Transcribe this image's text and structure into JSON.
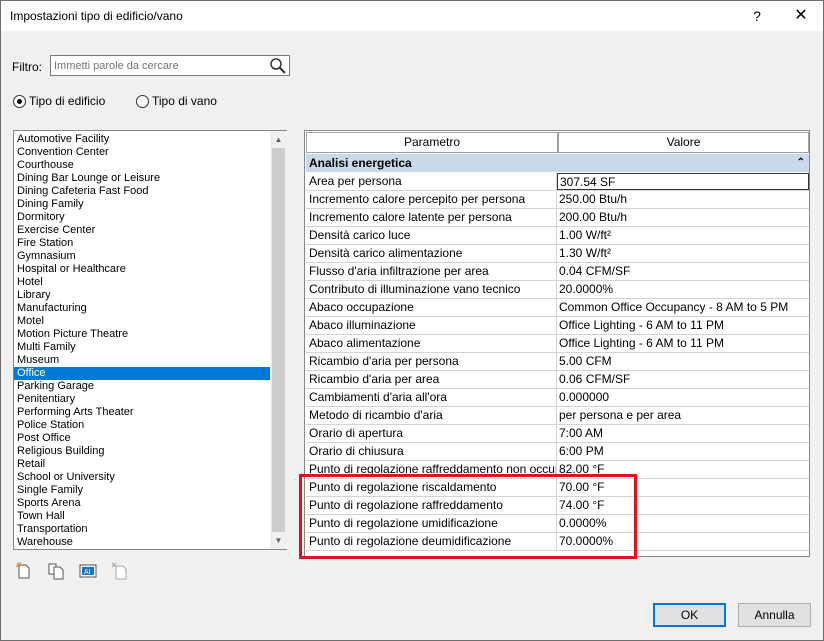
{
  "window": {
    "title": "Impostazioni tipo di edificio/vano",
    "help_label": "?",
    "close_label": "✕"
  },
  "filter": {
    "label": "Filtro:",
    "placeholder": "Immetti parole da cercare",
    "value": ""
  },
  "radios": [
    {
      "label": "Tipo di edificio",
      "checked": true
    },
    {
      "label": "Tipo di vano",
      "checked": false
    }
  ],
  "building_types": [
    "Automotive Facility",
    "Convention Center",
    "Courthouse",
    "Dining Bar Lounge or Leisure",
    "Dining Cafeteria Fast Food",
    "Dining Family",
    "Dormitory",
    "Exercise Center",
    "Fire Station",
    "Gymnasium",
    "Hospital or Healthcare",
    "Hotel",
    "Library",
    "Manufacturing",
    "Motel",
    "Motion Picture Theatre",
    "Multi Family",
    "Museum",
    "Office",
    "Parking Garage",
    "Penitentiary",
    "Performing Arts Theater",
    "Police Station",
    "Post Office",
    "Religious Building",
    "Retail",
    "School or University",
    "Single Family",
    "Sports Arena",
    "Town Hall",
    "Transportation",
    "Warehouse"
  ],
  "selected_type": "Office",
  "list_tools": [
    "new-type-icon",
    "duplicate-icon",
    "rename-icon",
    "delete-icon"
  ],
  "grid": {
    "col_param": "Parametro",
    "col_value": "Valore",
    "group": "Analisi energetica",
    "group_toggle": "⌃",
    "rows": [
      {
        "name": "Area per persona",
        "value": "307.54 SF"
      },
      {
        "name": "Incremento calore percepito per persona",
        "value": "250.00 Btu/h"
      },
      {
        "name": "Incremento calore latente per persona",
        "value": "200.00 Btu/h"
      },
      {
        "name": "Densità carico luce",
        "value": "1.00 W/ft²"
      },
      {
        "name": "Densità carico alimentazione",
        "value": "1.30 W/ft²"
      },
      {
        "name": "Flusso d'aria infiltrazione per area",
        "value": "0.04 CFM/SF"
      },
      {
        "name": "Contributo di illuminazione vano tecnico",
        "value": "20.0000%"
      },
      {
        "name": "Abaco occupazione",
        "value": "Common Office Occupancy - 8 AM to 5 PM"
      },
      {
        "name": "Abaco illuminazione",
        "value": "Office Lighting - 6 AM to 11 PM"
      },
      {
        "name": "Abaco alimentazione",
        "value": "Office Lighting - 6 AM to 11 PM"
      },
      {
        "name": "Ricambio d'aria per persona",
        "value": "5.00 CFM"
      },
      {
        "name": "Ricambio d'aria per area",
        "value": "0.06 CFM/SF"
      },
      {
        "name": "Cambiamenti d'aria all'ora",
        "value": "0.000000"
      },
      {
        "name": "Metodo di ricambio d'aria",
        "value": "per persona e per area"
      },
      {
        "name": "Orario di apertura",
        "value": "7:00 AM"
      },
      {
        "name": "Orario di chiusura",
        "value": "6:00 PM"
      },
      {
        "name": "Punto di regolazione raffreddamento non occupato",
        "value": "82.00 °F"
      },
      {
        "name": "Punto di regolazione riscaldamento",
        "value": "70.00 °F"
      },
      {
        "name": "Punto di regolazione raffreddamento",
        "value": "74.00 °F"
      },
      {
        "name": "Punto di regolazione umidificazione",
        "value": "0.0000%"
      },
      {
        "name": "Punto di regolazione deumidificazione",
        "value": "70.0000%"
      }
    ]
  },
  "buttons": {
    "ok": "OK",
    "cancel": "Annulla"
  },
  "colors": {
    "selection": "#0078d7",
    "group_header": "#c9d9e9",
    "highlight": "#e0131d"
  }
}
